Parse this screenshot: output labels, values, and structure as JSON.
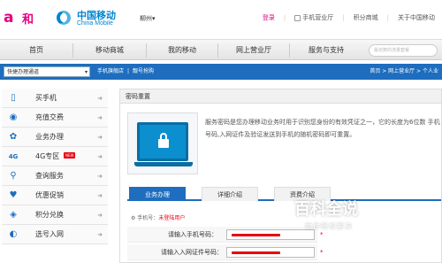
{
  "header": {
    "and_logo": {
      "a": "a",
      "he": "和"
    },
    "cm_logo": {
      "cn": "中国移动",
      "en": "China Mobile"
    },
    "city": "柳州",
    "city_arrow": "▾",
    "links": {
      "login": "登录",
      "sep": "|",
      "hall": "手机营业厅",
      "mall": "积分商城",
      "about": "关于中国移动"
    }
  },
  "nav": {
    "items": [
      "首页",
      "移动商城",
      "我的移动",
      "网上营业厅",
      "服务与支持"
    ],
    "search_placeholder": "最划算的流量套餐"
  },
  "bluebar": {
    "quick_select": "快捷办理通道",
    "quick_arrow": "▾",
    "links": [
      "手机旗舰店",
      "|",
      "靓号抢购"
    ],
    "breadcrumb": "首页 > 网上营业厅 > 个人业"
  },
  "sidebar": {
    "items": [
      {
        "icon": "▯",
        "label": "买手机",
        "arrow": "➜"
      },
      {
        "icon": "◉",
        "label": "充值交费",
        "arrow": "➜"
      },
      {
        "icon": "✿",
        "label": "业务办理",
        "arrow": "➜"
      },
      {
        "icon": "4G",
        "label": "4G专区",
        "badge": "NEW",
        "arrow": "➜"
      },
      {
        "icon": "⚲",
        "label": "查询服务",
        "arrow": "➜"
      },
      {
        "icon": "♥",
        "label": "优惠促销",
        "arrow": "➜"
      },
      {
        "icon": "◈",
        "label": "积分兑换",
        "arrow": "➜"
      },
      {
        "icon": "◐",
        "label": "选号入网",
        "arrow": "➜"
      }
    ]
  },
  "panel": {
    "title": "密码重置",
    "description": "服务密码是您办理移动业务时用于识别您身份的有效凭证之一，它的长度为6位数 手机号码,入网证件及验证发送到手机的随机密码即可重置。",
    "tabs": [
      "业务办理",
      "详细介绍",
      "资费介绍"
    ],
    "note_label": "手机号：",
    "note_value": "未登陆用户",
    "fields": [
      {
        "label": "请输入手机号码：",
        "required": "*"
      },
      {
        "label": "请输入入网证件号码：",
        "required": "*"
      }
    ]
  },
  "watermark": {
    "title": "百科全说",
    "subtitle": "助你轻松解决"
  },
  "colors": {
    "brand_blue": "#1e6dbe",
    "brand_pink": "#e4007f",
    "cm_blue": "#0085d0",
    "red": "#e60012"
  }
}
